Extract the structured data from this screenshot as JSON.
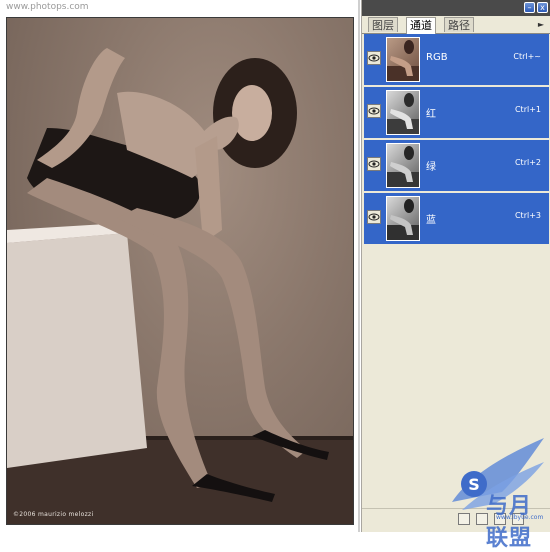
{
  "photo": {
    "watermark": "www.photops.com",
    "credit": "©2006 maurizio melozzi"
  },
  "panel": {
    "tabs": [
      {
        "label": "图层"
      },
      {
        "label": "通道"
      },
      {
        "label": "路径"
      }
    ],
    "active_tab": "通道",
    "titlebar_buttons": {
      "minimize": "–",
      "close": "x"
    },
    "menu_icon": "menu-triangle-icon",
    "channels": [
      {
        "name": "RGB",
        "shortcut": "Ctrl+~",
        "visible": true,
        "selected": true,
        "thumb": "color"
      },
      {
        "name": "红",
        "shortcut": "Ctrl+1",
        "visible": true,
        "selected": true,
        "thumb": "gray"
      },
      {
        "name": "绿",
        "shortcut": "Ctrl+2",
        "visible": true,
        "selected": true,
        "thumb": "gray"
      },
      {
        "name": "蓝",
        "shortcut": "Ctrl+3",
        "visible": true,
        "selected": true,
        "thumb": "gray"
      }
    ],
    "bottom_icons": [
      "load-selection-icon",
      "save-selection-icon",
      "new-channel-icon",
      "delete-channel-icon"
    ]
  },
  "logo": {
    "text": "与月联盟",
    "sub": "www.lbyue.com",
    "badge_letter": "S"
  },
  "colors": {
    "selection": "#3466c8",
    "panel_bg": "#ece9d8",
    "titlebar": "#4a4a4a"
  }
}
